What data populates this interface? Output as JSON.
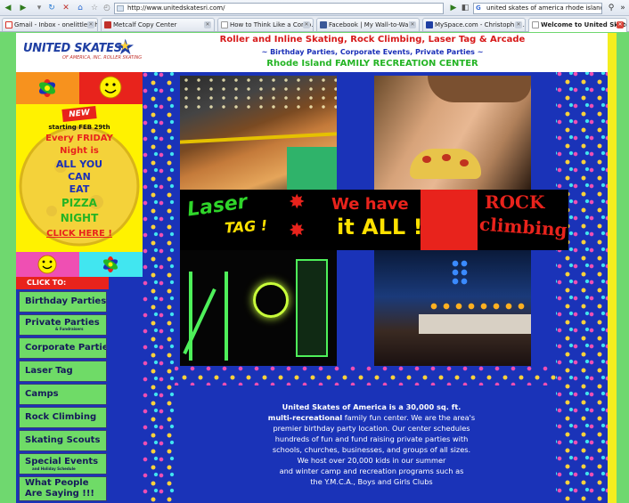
{
  "browser": {
    "url": "http://www.unitedskatesri.com/",
    "search": "united skates of america rhode island",
    "tabs": [
      {
        "label": "Gmail - Inbox - onelittlefish...",
        "color": "#d93025"
      },
      {
        "label": "Metcalf Copy Center",
        "color": "#c0312b"
      },
      {
        "label": "How to Think Like a Comp...",
        "color": "#ffffff"
      },
      {
        "label": "Facebook | My Wall-to-Wal...",
        "color": "#3b5998"
      },
      {
        "label": "MySpace.com - Christoph -...",
        "color": "#1f3fa3"
      },
      {
        "label": "Welcome to United Skate...",
        "color": "#ffffff"
      }
    ]
  },
  "header": {
    "logo_word": "UNITED SKATES",
    "logo_sub": "OF AMERICA, INC. ROLLER SKATING",
    "tagline1": "Roller and Inline Skating, Rock Climbing, Laser Tag & Arcade",
    "tagline2": "~ Birthday Parties, Corporate Events, Private Parties ~",
    "tagline3": "Rhode Island FAMILY RECREATION CENTER"
  },
  "promo": {
    "badge": "NEW",
    "lines": [
      {
        "text": "starting FEB 29th",
        "color": "#111111"
      },
      {
        "text": "Every FRIDAY",
        "color": "#e8231c"
      },
      {
        "text": "Night is",
        "color": "#e8231c"
      },
      {
        "text": "ALL YOU",
        "color": "#1a2fb8"
      },
      {
        "text": "CAN",
        "color": "#1a2fb8"
      },
      {
        "text": "EAT",
        "color": "#1a2fb8"
      },
      {
        "text": "PIZZA",
        "color": "#24b424"
      },
      {
        "text": "NIGHT",
        "color": "#24b424"
      },
      {
        "text": "CLICK HERE !",
        "color": "#e8231c"
      }
    ]
  },
  "menu": {
    "heading": "CLICK TO:",
    "items": [
      {
        "label": "Birthday Parties",
        "small": ""
      },
      {
        "label": "Private Parties",
        "small": "& Fundraisers"
      },
      {
        "label": "Corporate Parties",
        "small": ""
      },
      {
        "label": "Laser Tag",
        "small": ""
      },
      {
        "label": "Camps",
        "small": ""
      },
      {
        "label": "Rock Climbing",
        "small": ""
      },
      {
        "label": "Skating Scouts",
        "small": ""
      },
      {
        "label": "Special Events",
        "small": "and Holiday Schedule"
      },
      {
        "label": "What People Are Saying !!!",
        "small": ""
      }
    ]
  },
  "banner": {
    "laser": "Laser",
    "tag": "TAG !",
    "have": "We have",
    "all": "it ALL !",
    "rock": "ROCK",
    "climbing": "climbing"
  },
  "about": {
    "bold_lead": "United Skates of America is a 30,000 sq. ft.",
    "bold_lead2": "multi-recreational",
    "rest": [
      "family fun center. We are the area's",
      "premier birthday party location. Our center schedules",
      "hundreds of fun and fund raising private parties with",
      "schools, churches, businesses, and groups of all sizes.",
      "We host over 20,000 kids in our summer",
      "and winter camp and recreation programs such as",
      "the Y.M.C.A., Boys and Girls Clubs"
    ]
  }
}
